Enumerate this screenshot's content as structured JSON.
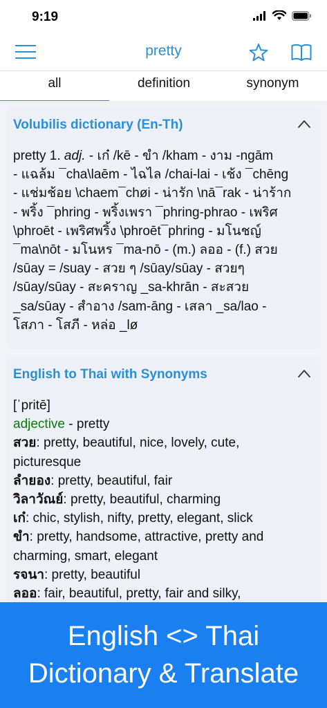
{
  "status": {
    "time": "9:19"
  },
  "nav": {
    "title": "pretty"
  },
  "tabs": [
    "all",
    "definition",
    "synonym"
  ],
  "card1": {
    "title": "Volubilis dictionary (En-Th)",
    "lines": [
      "pretty 1. adj. - เก๋ /kē - ขำ /kham - งาม -ngām",
      "- แฉล้ม ¯cha\\laēm - ไฉไล /chai-lai - เช้ง ¯chēng",
      "- แช่มช้อย \\chaem¯chøi - น่ารัก \\nā¯rak - น่าร้าก",
      "- พริ้ง ¯phring - พริ้งเพรา ¯phring-phrao - เพริศ",
      "\\phroēt - เพริศพริ้ง \\phroēt¯phring - มโนชญ์",
      "¯ma\\nōt - มโนหร ¯ma-nō - (m.) ลออ - (f.) สวย",
      "/sūay = /suay - สวย ๆ /sūay/sūay - สวยๆ",
      "/sūay/sūay - สะคราญ _sa-khrān - สะสวย",
      "_sa/sūay - สำอาง /sam-āng - เสลา _sa/lao -",
      "โสภา - โสภี - หล่อ _lø"
    ]
  },
  "card2": {
    "title": "English to Thai with Synonyms",
    "pron": "[ˈpritē]",
    "pos": "adjective",
    "pos_rest": " - pretty",
    "entries": [
      {
        "head": "สวย",
        "rest": ": pretty, beautiful, nice, lovely, cute,"
      },
      {
        "head": "",
        "rest": "picturesque"
      },
      {
        "head": "ลำยอง",
        "rest": ": pretty, beautiful, fair"
      },
      {
        "head": "วิลาวัณย์",
        "rest": ": pretty, beautiful, charming"
      },
      {
        "head": "เก๋",
        "rest": ": chic, stylish, nifty, pretty, elegant, slick"
      },
      {
        "head": "ขำ",
        "rest": ": pretty, handsome, attractive, pretty and"
      },
      {
        "head": "",
        "rest": "charming, smart, elegant"
      },
      {
        "head": "รจนา",
        "rest": ": pretty, beautiful"
      },
      {
        "head": "ลออ",
        "rest": ": fair, beautiful, pretty, fair and silky,"
      }
    ]
  },
  "banner": {
    "line1": "English <> Thai",
    "line2": "Dictionary & Translate"
  },
  "colors": {
    "accent": "#2c8fd6",
    "banner": "#1a7ff0",
    "pos": "#0a7a0a"
  },
  "icons": [
    "menu-icon",
    "star-icon",
    "book-icon",
    "chevron-up-icon",
    "signal-icon",
    "wifi-icon",
    "battery-icon"
  ]
}
